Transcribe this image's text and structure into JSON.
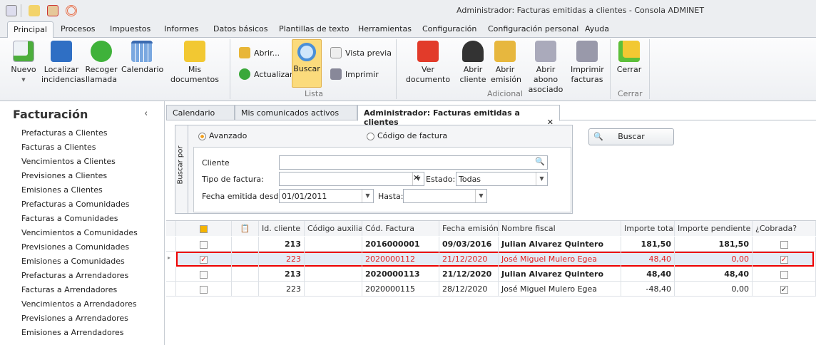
{
  "window": {
    "title": "Administrador: Facturas emitidas a clientes - Consola ADMINET"
  },
  "ribbon_tabs": [
    "Principal",
    "Procesos",
    "Impuestos",
    "Informes",
    "Datos básicos",
    "Plantillas de texto",
    "Herramientas",
    "Configuración",
    "Configuración personal",
    "Ayuda"
  ],
  "ribbon": {
    "nuevo": "Nuevo",
    "localizar": [
      "Localizar",
      "incidencias"
    ],
    "recoger": [
      "Recoger",
      "llamada"
    ],
    "calendario": "Calendario",
    "mis_documentos": "Mis documentos",
    "abrir": "Abrir...",
    "actualizar": "Actualizar",
    "buscar": "Buscar",
    "vista_previa": "Vista previa",
    "imprimir": "Imprimir",
    "group_lista": "Lista",
    "ver_documento": "Ver documento",
    "abrir_cliente": [
      "Abrir",
      "cliente"
    ],
    "abrir_emision": [
      "Abrir",
      "emisión"
    ],
    "abrir_abono": [
      "Abrir abono",
      "asociado"
    ],
    "imprimir_facturas": [
      "Imprimir",
      "facturas"
    ],
    "group_adicional": "Adicional",
    "cerrar": "Cerrar",
    "group_cerrar": "Cerrar"
  },
  "sidebar": {
    "title": "Facturación",
    "items": [
      "Prefacturas a Clientes",
      "Facturas a Clientes",
      "Vencimientos a Clientes",
      "Previsiones a Clientes",
      "Emisiones a Clientes",
      "Prefacturas a Comunidades",
      "Facturas a Comunidades",
      "Vencimientos a Comunidades",
      "Previsiones a Comunidades",
      "Emisiones a Comunidades",
      "Prefacturas a Arrendadores",
      "Facturas a Arrendadores",
      "Vencimientos a Arrendadores",
      "Previsiones a Arrendadores",
      "Emisiones a Arrendadores"
    ]
  },
  "doc_tabs": [
    "Calendario",
    "Mis comunicados activos",
    "Administrador: Facturas emitidas a clientes"
  ],
  "search": {
    "panel_label": "Buscar por",
    "mode_avanzado": "Avanzado",
    "mode_codigo": "Código de factura",
    "cliente_label": "Cliente",
    "cliente_value": "",
    "tipo_label": "Tipo de factura:",
    "tipo_value": "",
    "estado_label": "Estado:",
    "estado_value": "Todas",
    "fecha_label": "Fecha emitida desde:",
    "fecha_value": "01/01/2011",
    "hasta_label": "Hasta:",
    "hasta_value": "",
    "buscar_button": "Buscar"
  },
  "grid": {
    "columns": [
      "Id. cliente",
      "Código auxiliar",
      "Cód. Factura",
      "Fecha emisión",
      "Nombre fiscal",
      "Importe total",
      "Importe pendiente",
      "¿Cobrada?"
    ],
    "rows": [
      {
        "id": "213",
        "aux": "",
        "cod": "2016000001",
        "fecha": "09/03/2016",
        "nombre": "Julian Alvarez Quintero",
        "total": "181,50",
        "pendiente": "181,50",
        "cobrada": false,
        "checked": false,
        "bold": true
      },
      {
        "id": "223",
        "aux": "",
        "cod": "2020000112",
        "fecha": "21/12/2020",
        "nombre": "José Miguel Mulero Egea",
        "total": "48,40",
        "pendiente": "0,00",
        "cobrada": true,
        "checked": true,
        "bold": false,
        "selected": true
      },
      {
        "id": "213",
        "aux": "",
        "cod": "2020000113",
        "fecha": "21/12/2020",
        "nombre": "Julian Alvarez Quintero",
        "total": "48,40",
        "pendiente": "48,40",
        "cobrada": false,
        "checked": false,
        "bold": true
      },
      {
        "id": "223",
        "aux": "",
        "cod": "2020000115",
        "fecha": "28/12/2020",
        "nombre": "José Miguel Mulero Egea",
        "total": "-48,40",
        "pendiente": "0,00",
        "cobrada": true,
        "checked": false,
        "bold": false
      }
    ]
  }
}
